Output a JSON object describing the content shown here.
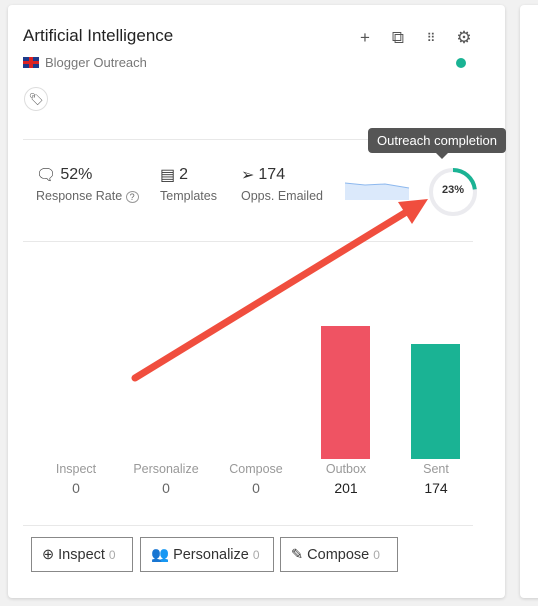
{
  "card": {
    "title": "Artificial Intelligence",
    "campaign_type": "Blogger Outreach",
    "status_color": "#1ab394"
  },
  "header_icons": [
    "plus-icon",
    "copy-icon",
    "grid-icon",
    "gear-icon"
  ],
  "stats": [
    {
      "value": "52%",
      "label": "Response Rate",
      "icon": "chat-check-icon"
    },
    {
      "value": "2",
      "label": "Templates",
      "icon": "document-icon"
    },
    {
      "value": "174",
      "label": "Opps. Emailed",
      "icon": "send-icon"
    }
  ],
  "completion": {
    "percent": 23,
    "label": "23%",
    "tooltip": "Outreach completion",
    "color": "#1ab394"
  },
  "pipeline": [
    {
      "name": "Inspect",
      "count": "0",
      "value": 0
    },
    {
      "name": "Personalize",
      "count": "0",
      "value": 0
    },
    {
      "name": "Compose",
      "count": "0",
      "value": 0
    },
    {
      "name": "Outbox",
      "count": "201",
      "value": 201,
      "color": "#ef5363"
    },
    {
      "name": "Sent",
      "count": "174",
      "value": 174,
      "color": "#1ab394"
    }
  ],
  "buttons": [
    {
      "label": "Inspect",
      "count": "0"
    },
    {
      "label": "Personalize",
      "count": "0"
    },
    {
      "label": "Compose",
      "count": "0"
    }
  ],
  "annotation_color": "#f04e3e"
}
